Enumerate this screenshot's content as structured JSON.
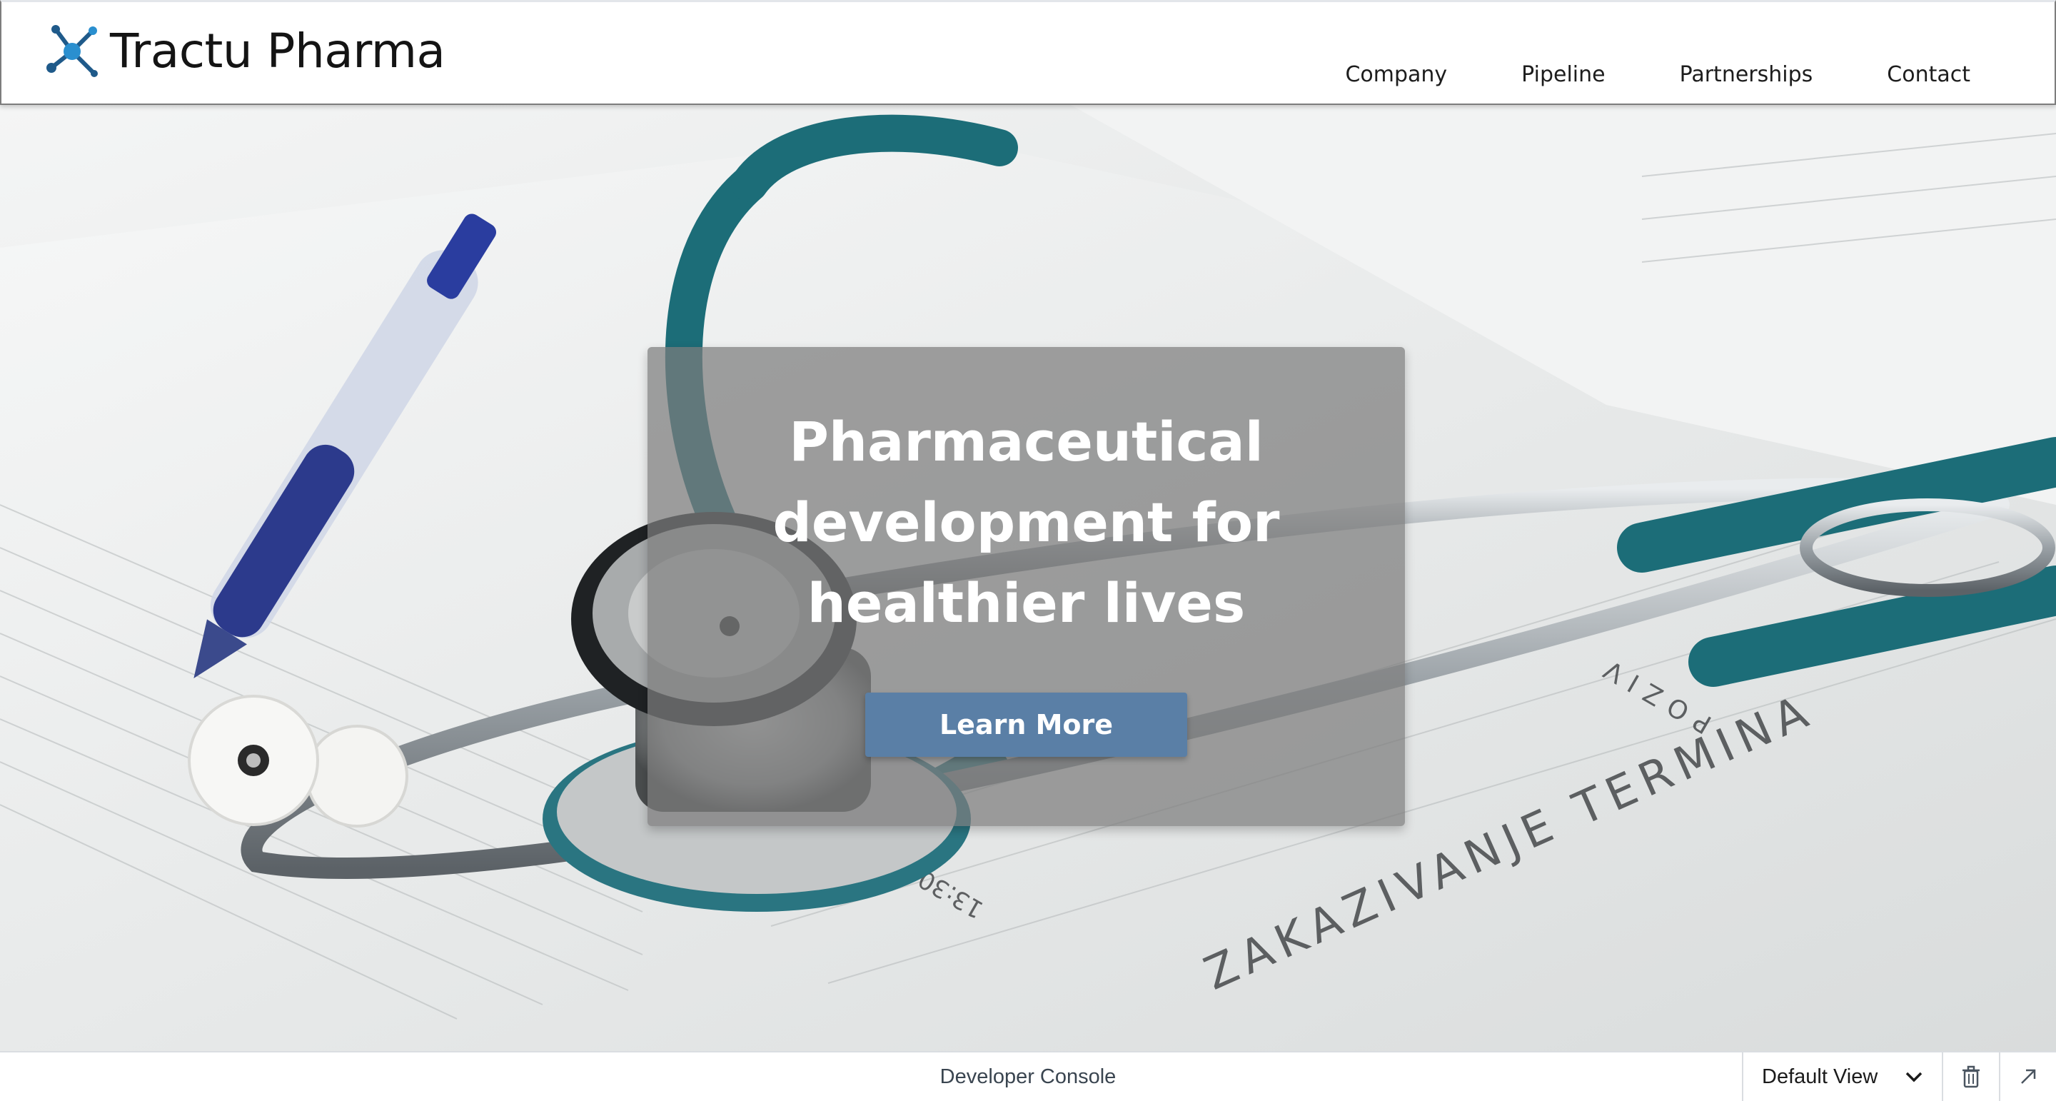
{
  "brand": {
    "name": "Tractu Pharma",
    "icon": "molecule-logo-icon",
    "colors": {
      "dark": "#1f5a8a",
      "light": "#2a8fcf"
    }
  },
  "nav": {
    "items": [
      {
        "label": "Company"
      },
      {
        "label": "Pipeline"
      },
      {
        "label": "Partnerships"
      },
      {
        "label": "Contact"
      }
    ]
  },
  "hero": {
    "title": "Pharmaceutical development for healthier lives",
    "cta_label": "Learn More",
    "image": "stethoscope-on-medical-form",
    "cta_color": "#5a7fa6"
  },
  "scroll_top": {
    "icon": "chevron-up-icon",
    "color": "#1f4e80"
  },
  "console": {
    "title": "Developer Console",
    "view_selected": "Default View",
    "icons": [
      "chevron-down-icon",
      "trash-icon",
      "pop-out-icon"
    ]
  }
}
